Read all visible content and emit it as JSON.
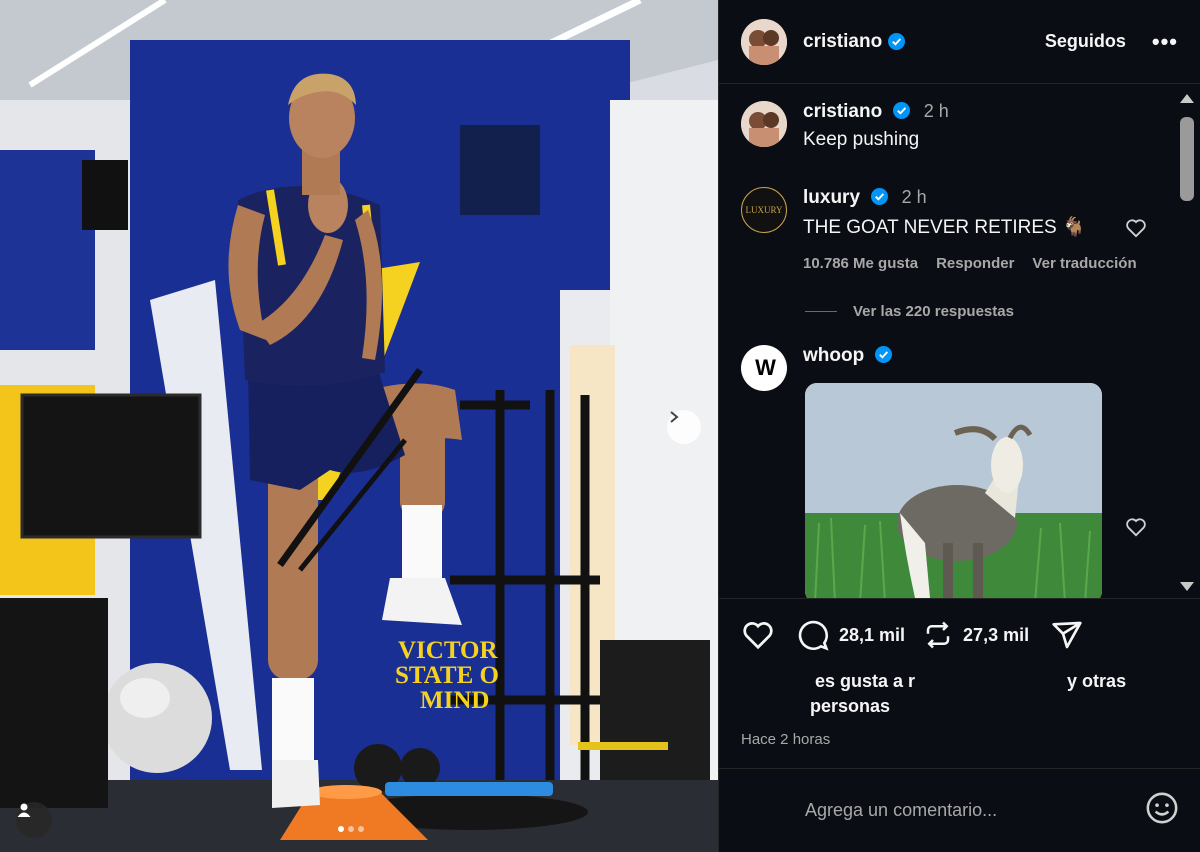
{
  "post": {
    "author": "cristiano",
    "follow_label": "Seguidos",
    "more_label": "•••",
    "photo_text_line1": "VICTOR",
    "photo_text_line2": "STATE O",
    "photo_text_line3": "MIND"
  },
  "comments": [
    {
      "user": "cristiano",
      "time": "2 h",
      "text": "Keep pushing"
    },
    {
      "user": "luxury",
      "avatar_text": "LUXURY",
      "time": "2 h",
      "text": "THE GOAT NEVER RETIRES 🐐",
      "likes": "10.786 Me gusta",
      "reply_label": "Responder",
      "translate_label": "Ver traducción",
      "view_replies": "Ver las 220 respuestas"
    },
    {
      "user": "whoop",
      "avatar_text": "W"
    }
  ],
  "actions": {
    "comments_count": "28,1 mil",
    "reposts_count": "27,3 mil",
    "likes_line_a": "es gusta a r",
    "likes_line_b": "y otras",
    "likes_line_c": "personas",
    "time_ago": "Hace 2 horas"
  },
  "compose": {
    "placeholder": "Agrega un comentario..."
  },
  "colors": {
    "panel_bg": "#0b0d14",
    "verified": "#0095f6",
    "photo_wall": "#1d2f8a",
    "accent_yellow": "#f4d21f"
  }
}
